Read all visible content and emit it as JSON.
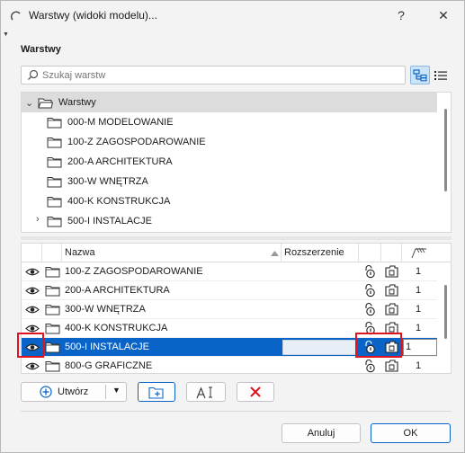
{
  "window": {
    "title": "Warstwy (widoki modelu)...",
    "help_label": "?",
    "close_label": "✕"
  },
  "section": {
    "title": "Warstwy"
  },
  "search": {
    "placeholder": "Szukaj warstw"
  },
  "tree": {
    "root_label": "Warstwy",
    "items": [
      {
        "label": "000-M MODELOWANIE",
        "expandable": false
      },
      {
        "label": "100-Z ZAGOSPODAROWANIE",
        "expandable": false
      },
      {
        "label": "200-A ARCHITEKTURA",
        "expandable": false
      },
      {
        "label": "300-W WNĘTRZA",
        "expandable": false
      },
      {
        "label": "400-K KONSTRUKCJA",
        "expandable": false
      },
      {
        "label": "500-I INSTALACJE",
        "expandable": true
      }
    ]
  },
  "table": {
    "columns": {
      "name": "Nazwa",
      "extension": "Rozszerzenie"
    },
    "rows": [
      {
        "name": "100-Z ZAGOSPODAROWANIE",
        "num": "1",
        "selected": false
      },
      {
        "name": "200-A ARCHITEKTURA",
        "num": "1",
        "selected": false
      },
      {
        "name": "300-W WNĘTRZA",
        "num": "1",
        "selected": false
      },
      {
        "name": "400-K KONSTRUKCJA",
        "num": "1",
        "selected": false
      },
      {
        "name": "500-I INSTALACJE",
        "num": "1",
        "selected": true
      },
      {
        "name": "800-G GRAFICZNE",
        "num": "1",
        "selected": false
      }
    ]
  },
  "toolbar": {
    "create_label": "Utwórz"
  },
  "footer": {
    "cancel_label": "Anuluj",
    "ok_label": "OK"
  },
  "colors": {
    "selection": "#0a64c8",
    "highlight": "#e0141e",
    "delete_icon": "#e0141e"
  }
}
